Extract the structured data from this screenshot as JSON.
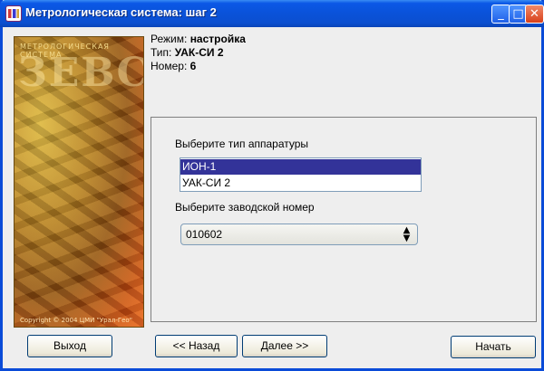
{
  "window": {
    "title": "Метрологическая система: шаг 2",
    "controls": {
      "minimize": "_",
      "maximize": "□",
      "close": "✕"
    }
  },
  "side_panel": {
    "caption": "МЕТРОЛОГИЧЕСКАЯ СИСТЕМА",
    "logo": "ЗЕВС",
    "copyright": "Copyright © 2004 ЦМИ \"Урал-Гео\""
  },
  "info": {
    "mode_label": "Режим:",
    "mode_value": "настройка",
    "type_label": "Тип:",
    "type_value": "УАК-СИ 2",
    "number_label": "Номер:",
    "number_value": "6"
  },
  "form": {
    "equipment_type_label": "Выберите тип аппаратуры",
    "equipment_types": [
      "ИОН-1",
      "УАК-СИ 2"
    ],
    "selected_equipment_type": "ИОН-1",
    "serial_label": "Выберите заводской номер",
    "serial_value": "010602"
  },
  "buttons": {
    "exit": "Выход",
    "back": "<< Назад",
    "next": "Далее >>",
    "start": "Начать"
  },
  "colors": {
    "title_bar": "#0b58e6",
    "selection": "#333399"
  }
}
